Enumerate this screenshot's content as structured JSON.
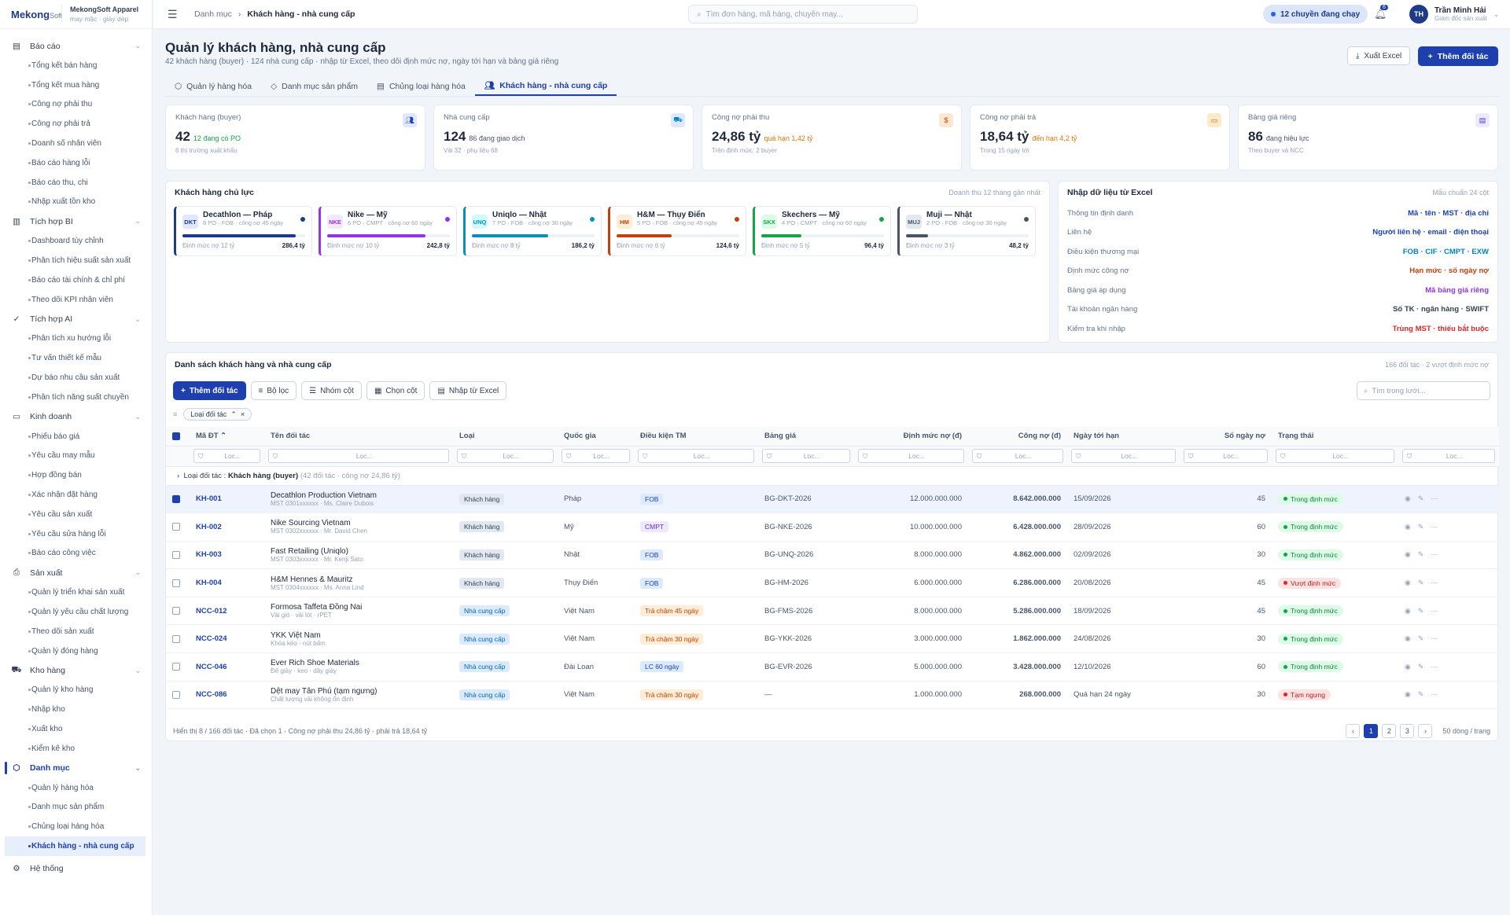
{
  "brand": {
    "logo": "Mekong",
    "logo_suffix": "Soft",
    "name": "MekongSoft Apparel",
    "sub": "may mặc · giày dép"
  },
  "nav": [
    {
      "label": "Báo cáo",
      "icon": "report-icon",
      "items": [
        "Tổng kết bán hàng",
        "Tổng kết mua hàng",
        "Công nợ phải thu",
        "Công nợ phải trả",
        "Doanh số nhân viên",
        "Báo cáo hàng lỗi",
        "Báo cáo thu, chi",
        "Nhập xuất tồn kho"
      ]
    },
    {
      "label": "Tích hợp BI",
      "icon": "bar-chart-icon",
      "items": [
        "Dashboard tùy chỉnh",
        "Phân tích hiệu suất sản xuất",
        "Báo cáo tài chính & chỉ phí",
        "Theo dõi KPI nhân viên"
      ]
    },
    {
      "label": "Tích hợp AI",
      "icon": "ai-check-icon",
      "items": [
        "Phân tích xu hướng lỗi",
        "Tư vấn thiết kế mẫu",
        "Dự báo nhu cầu sản xuất",
        "Phân tích năng suất chuyền"
      ]
    },
    {
      "label": "Kinh doanh",
      "icon": "money-icon",
      "items": [
        "Phiếu báo giá",
        "Yêu cầu may mẫu",
        "Hợp đồng bán",
        "Xác nhận đặt hàng",
        "Yêu cầu sản xuất",
        "Yêu cầu sửa hàng lỗi",
        "Báo cáo công việc"
      ]
    },
    {
      "label": "Sản xuất",
      "icon": "printer-icon",
      "items": [
        "Quản lý triển khai sản xuất",
        "Quản lý yêu cầu chất lượng",
        "Theo dõi sản xuất",
        "Quản lý đóng hàng"
      ]
    },
    {
      "label": "Kho hàng",
      "icon": "truck-icon",
      "items": [
        "Quản lý kho hàng",
        "Nhập kho",
        "Xuất kho",
        "Kiểm kê kho"
      ]
    },
    {
      "label": "Danh mục",
      "icon": "box-icon",
      "active": true,
      "items": [
        "Quản lý hàng hóa",
        "Danh mục sản phẩm",
        "Chủng loại hàng hóa",
        "Khách hàng - nhà cung cấp"
      ]
    },
    {
      "label": "Hệ thống",
      "icon": "gear-icon",
      "items": []
    }
  ],
  "topbar": {
    "crumb_root": "Danh mục",
    "crumb_current": "Khách hàng - nhà cung cấp",
    "search_placeholder": "Tìm đơn hàng, mã hàng, chuyền may...",
    "pill": "12 chuyền đang chạy",
    "notif_count": "6",
    "user_initials": "TH",
    "user_name": "Trần Minh Hải",
    "user_role": "Giám đốc sản xuất"
  },
  "page": {
    "title": "Quản lý khách hàng, nhà cung cấp",
    "subtitle": "42 khách hàng (buyer) · 124 nhà cung cấp · nhập từ Excel, theo dõi định mức nợ, ngày tới hạn và bảng giá riêng",
    "export_label": "Xuất Excel",
    "add_label": "Thêm đối tác"
  },
  "tabs": [
    "Quản lý hàng hóa",
    "Danh mục sản phẩm",
    "Chủng loại hàng hóa",
    "Khách hàng - nhà cung cấp"
  ],
  "kpis": [
    {
      "label": "Khách hàng (buyer)",
      "value": "42",
      "note": "12 đang có PO",
      "note_color": "#16a34a",
      "hint": "6 thị trường xuất khẩu",
      "icon": "users-icon",
      "icon_bg": "#e0e7ff",
      "icon_color": "#1e40af"
    },
    {
      "label": "Nhà cung cấp",
      "value": "124",
      "note": "86 đang giao dịch",
      "note_color": "#475569",
      "hint": "Vải 32 · phụ liệu 68",
      "icon": "truck-icon",
      "icon_bg": "#dbeafe",
      "icon_color": "#0284c7"
    },
    {
      "label": "Công nợ phải thu",
      "value": "24,86 tỷ",
      "note": "quá hạn 1,42 tỷ",
      "note_color": "#d97706",
      "hint": "Trên định mức: 2 buyer",
      "icon": "dollar-icon",
      "icon_bg": "#fde7d0",
      "icon_color": "#c2410c"
    },
    {
      "label": "Công nợ phải trả",
      "value": "18,64 tỷ",
      "note": "đến hạn 4,2 tỷ",
      "note_color": "#d97706",
      "hint": "Trong 15 ngày tới",
      "icon": "cash-icon",
      "icon_bg": "#fdebc8",
      "icon_color": "#b45309"
    },
    {
      "label": "Bảng giá riêng",
      "value": "86",
      "note": "đang hiệu lực",
      "note_color": "#475569",
      "hint": "Theo buyer và NCC",
      "icon": "document-icon",
      "icon_bg": "#ede9fe",
      "icon_color": "#4338ca"
    }
  ],
  "key_customers": {
    "title": "Khách hàng chủ lực",
    "note": "Doanh thu 12 tháng gần nhất",
    "items": [
      {
        "badge": "DKT",
        "name": "Decathlon — Pháp",
        "sub": "8 PO · FOB · công nợ 45 ngày",
        "limit": "Định mức nợ 12 tỷ",
        "revenue": "286,4 tỷ",
        "color": "#1e3a8a",
        "badge_bg": "#e0e7ff",
        "fill": 0.92
      },
      {
        "badge": "NKE",
        "name": "Nike — Mỹ",
        "sub": "6 PO · CMPT · công nợ 60 ngày",
        "limit": "Định mức nợ 10 tỷ",
        "revenue": "242,8 tỷ",
        "color": "#9333ea",
        "badge_bg": "#f3e8ff",
        "fill": 0.8
      },
      {
        "badge": "UNQ",
        "name": "Uniqlo — Nhật",
        "sub": "7 PO · FOB · công nợ 30 ngày",
        "limit": "Định mức nợ 8 tỷ",
        "revenue": "186,2 tỷ",
        "color": "#0891b2",
        "badge_bg": "#cffafe",
        "fill": 0.62
      },
      {
        "badge": "HM",
        "name": "H&M — Thụy Điển",
        "sub": "5 PO · FOB · công nợ 45 ngày",
        "limit": "Định mức nợ 6 tỷ",
        "revenue": "124,6 tỷ",
        "color": "#c2410c",
        "badge_bg": "#ffedd5",
        "fill": 0.45
      },
      {
        "badge": "SKX",
        "name": "Skechers — Mỹ",
        "sub": "4 PO · CMPT · công nợ 60 ngày",
        "limit": "Định mức nợ 5 tỷ",
        "revenue": "96,4 tỷ",
        "color": "#16a34a",
        "badge_bg": "#dcfce7",
        "fill": 0.33
      },
      {
        "badge": "MUJ",
        "name": "Muji — Nhật",
        "sub": "2 PO · FOB · công nợ 30 ngày",
        "limit": "Định mức nợ 3 tỷ",
        "revenue": "48,2 tỷ",
        "color": "#475569",
        "badge_bg": "#e2e8f0",
        "fill": 0.18
      }
    ]
  },
  "excel_import": {
    "title": "Nhập dữ liệu từ Excel",
    "note": "Mẫu chuẩn 24 cột",
    "rows": [
      {
        "label": "Thông tin định danh",
        "value": "Mã · tên · MST · địa chỉ",
        "color": "#1e40af"
      },
      {
        "label": "Liên hệ",
        "value": "Người liên hệ · email · điện thoại",
        "color": "#1e40af"
      },
      {
        "label": "Điều kiện thương mại",
        "value": "FOB · CIF · CMPT · EXW",
        "color": "#0284c7"
      },
      {
        "label": "Định mức công nợ",
        "value": "Hạn mức · số ngày nợ",
        "color": "#c2410c"
      },
      {
        "label": "Bảng giá áp dụng",
        "value": "Mã bảng giá riêng",
        "color": "#9333ea"
      },
      {
        "label": "Tài khoản ngân hàng",
        "value": "Số TK · ngân hàng · SWIFT",
        "color": "#334155"
      },
      {
        "label": "Kiểm tra khi nhập",
        "value": "Trùng MST · thiếu bắt buộc",
        "color": "#dc2626"
      }
    ]
  },
  "table": {
    "title": "Danh sách khách hàng và nhà cung cấp",
    "note": "166 đối tác · 2 vượt định mức nợ",
    "toolbar": {
      "add": "Thêm đối tác",
      "filter": "Bộ lọc",
      "group": "Nhóm cột",
      "columns": "Chọn cột",
      "import": "Nhập từ Excel",
      "search_placeholder": "Tìm trong lưới..."
    },
    "group_chip": "Loại đối tác",
    "columns": [
      "Mã ĐT",
      "Tên đối tác",
      "Loại",
      "Quốc gia",
      "Điều kiện TM",
      "Bảng giá",
      "Định mức nợ (đ)",
      "Công nợ (đ)",
      "Ngày tới hạn",
      "Số ngày nợ",
      "Trạng thái"
    ],
    "filter_placeholder": "Lọc...",
    "group_row": {
      "label": "Loại đối tác",
      "value": "Khách hàng (buyer)",
      "count": "(42 đối tác · công nợ 24,86 tỷ)"
    },
    "rows": [
      {
        "code": "KH-001",
        "name": "Decathlon Production Vietnam",
        "sub": "MST 0301xxxxxx · Ms. Claire Dubois",
        "type": "Khách hàng",
        "country": "Pháp",
        "term": "FOB",
        "term_kind": "blue",
        "price": "BG-DKT-2026",
        "limit": "12.000.000.000",
        "debt": "8.642.000.000",
        "due": "15/09/2026",
        "days": "45",
        "status": "Trong định mức",
        "status_kind": "ok",
        "selected": true
      },
      {
        "code": "KH-002",
        "name": "Nike Sourcing Vietnam",
        "sub": "MST 0302xxxxxx · Mr. David Chen",
        "type": "Khách hàng",
        "country": "Mỹ",
        "term": "CMPT",
        "term_kind": "purple",
        "price": "BG-NKE-2026",
        "limit": "10.000.000.000",
        "debt": "6.428.000.000",
        "due": "28/09/2026",
        "days": "60",
        "status": "Trong định mức",
        "status_kind": "ok",
        "selected": false
      },
      {
        "code": "KH-003",
        "name": "Fast Retailing (Uniqlo)",
        "sub": "MST 0303xxxxxx · Mr. Kenji Sato",
        "type": "Khách hàng",
        "country": "Nhật",
        "term": "FOB",
        "term_kind": "blue",
        "price": "BG-UNQ-2026",
        "limit": "8.000.000.000",
        "debt": "4.862.000.000",
        "due": "02/09/2026",
        "days": "30",
        "status": "Trong định mức",
        "status_kind": "ok",
        "selected": false
      },
      {
        "code": "KH-004",
        "name": "H&M Hennes & Mauritz",
        "sub": "MST 0304xxxxxx · Ms. Anna Lind",
        "type": "Khách hàng",
        "country": "Thụy Điển",
        "term": "FOB",
        "term_kind": "blue",
        "price": "BG-HM-2026",
        "limit": "6.000.000.000",
        "debt": "6.286.000.000",
        "due": "20/08/2026",
        "days": "45",
        "status": "Vượt định mức",
        "status_kind": "bad",
        "selected": false
      },
      {
        "code": "NCC-012",
        "name": "Formosa Taffeta Đồng Nai",
        "sub": "Vải gió · vải lót · rPET",
        "type": "Nhà cung cấp",
        "country": "Việt Nam",
        "term": "Trả chậm 45 ngày",
        "term_kind": "orange",
        "price": "BG-FMS-2026",
        "limit": "8.000.000.000",
        "debt": "5.286.000.000",
        "due": "18/09/2026",
        "days": "45",
        "status": "Trong định mức",
        "status_kind": "ok",
        "selected": false
      },
      {
        "code": "NCC-024",
        "name": "YKK Việt Nam",
        "sub": "Khóa kéo · nút bấm",
        "type": "Nhà cung cấp",
        "country": "Việt Nam",
        "term": "Trả chậm 30 ngày",
        "term_kind": "orange",
        "price": "BG-YKK-2026",
        "limit": "3.000.000.000",
        "debt": "1.862.000.000",
        "due": "24/08/2026",
        "days": "30",
        "status": "Trong định mức",
        "status_kind": "ok",
        "selected": false
      },
      {
        "code": "NCC-046",
        "name": "Ever Rich Shoe Materials",
        "sub": "Đế giày · keo · dây giày",
        "type": "Nhà cung cấp",
        "country": "Đài Loan",
        "term": "LC 60 ngày",
        "term_kind": "blue",
        "price": "BG-EVR-2026",
        "limit": "5.000.000.000",
        "debt": "3.428.000.000",
        "due": "12/10/2026",
        "days": "60",
        "status": "Trong định mức",
        "status_kind": "ok",
        "selected": false
      },
      {
        "code": "NCC-086",
        "name": "Dệt may Tân Phú (tạm ngưng)",
        "sub": "Chất lượng vải không ổn định",
        "type": "Nhà cung cấp",
        "country": "Việt Nam",
        "term": "Trả chậm 30 ngày",
        "term_kind": "orange",
        "price": "—",
        "limit": "1.000.000.000",
        "debt": "268.000.000",
        "due": "Quá hạn 24 ngày",
        "days": "30",
        "status": "Tạm ngưng",
        "status_kind": "bad",
        "selected": false
      }
    ],
    "footer": "Hiển thị 8 / 166 đối tác · Đã chọn 1 · Công nợ phải thu 24,86 tỷ · phải trả 18,64 tỷ",
    "pages": [
      "1",
      "2",
      "3"
    ],
    "per_page": "50 dòng / trang"
  },
  "colors": {
    "accent": "#1e40af",
    "ok": "#16a34a",
    "bad": "#dc2626"
  }
}
